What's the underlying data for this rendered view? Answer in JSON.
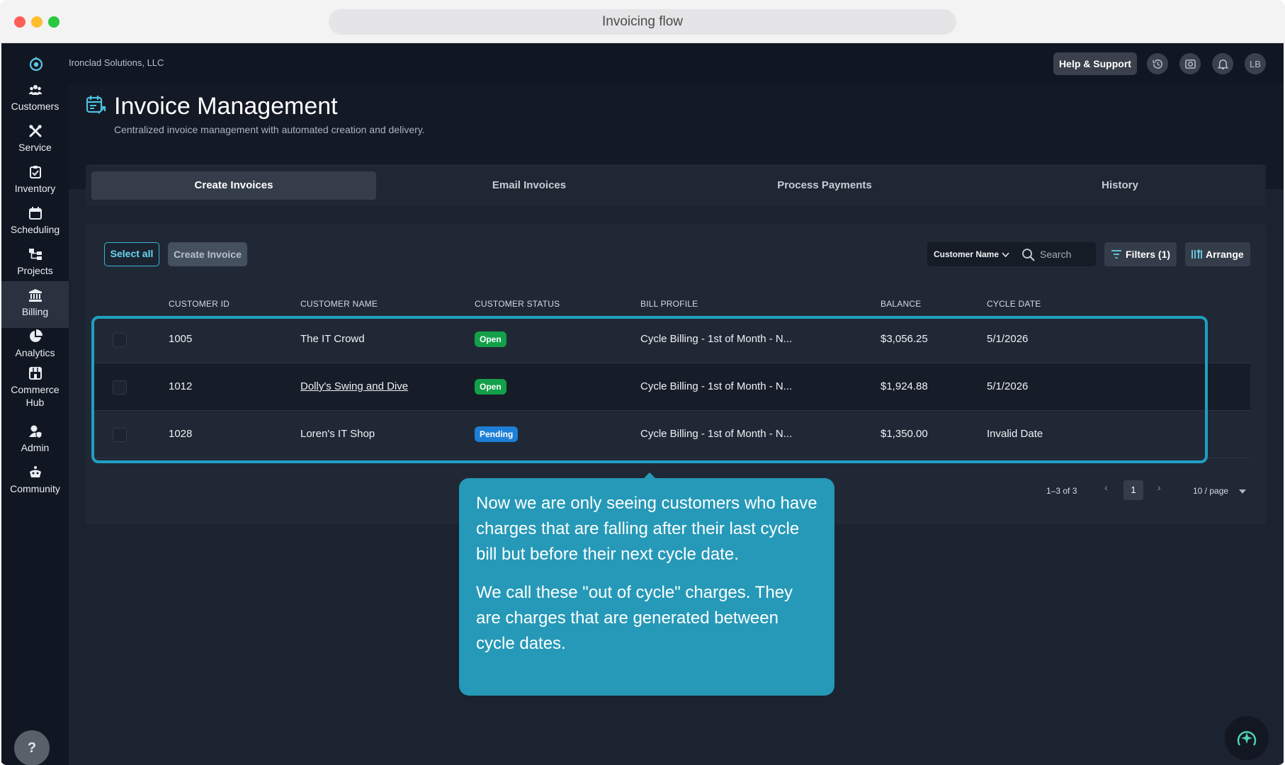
{
  "window": {
    "url_title": "Invoicing flow"
  },
  "header": {
    "company": "Ironclad Solutions, LLC",
    "help_label": "Help & Support",
    "avatar_initials": "LB"
  },
  "sidebar": {
    "items": [
      {
        "label": "Customers",
        "icon": "people-icon"
      },
      {
        "label": "Service",
        "icon": "tools-icon"
      },
      {
        "label": "Inventory",
        "icon": "clipboard-check-icon"
      },
      {
        "label": "Scheduling",
        "icon": "calendar-icon"
      },
      {
        "label": "Projects",
        "icon": "hierarchy-icon"
      },
      {
        "label": "Billing",
        "icon": "bank-icon",
        "active": true
      },
      {
        "label": "Analytics",
        "icon": "pie-chart-icon"
      },
      {
        "label": "Commerce Hub",
        "icon": "storefront-icon"
      },
      {
        "label": "Admin",
        "icon": "user-shield-icon"
      },
      {
        "label": "Community",
        "icon": "community-icon"
      }
    ],
    "help_fab": "?"
  },
  "page": {
    "title": "Invoice Management",
    "subtitle": "Centralized invoice management with automated creation and delivery."
  },
  "tabs": [
    {
      "label": "Create Invoices",
      "active": true
    },
    {
      "label": "Email Invoices"
    },
    {
      "label": "Process Payments"
    },
    {
      "label": "History"
    }
  ],
  "toolbar": {
    "select_all": "Select all",
    "create_invoice": "Create Invoice",
    "search_field": "Customer Name",
    "search_placeholder": "Search",
    "filters": "Filters (1)",
    "arrange": "Arrange"
  },
  "table": {
    "columns": [
      "CUSTOMER ID",
      "CUSTOMER NAME",
      "CUSTOMER STATUS",
      "BILL PROFILE",
      "BALANCE",
      "CYCLE DATE"
    ],
    "rows": [
      {
        "id": "1005",
        "name": "The IT Crowd",
        "status": "Open",
        "profile": "Cycle Billing - 1st of Month - N...",
        "balance": "$3,056.25",
        "cycle": "5/1/2026"
      },
      {
        "id": "1012",
        "name": "Dolly's Swing and Dive",
        "status": "Open",
        "profile": "Cycle Billing - 1st of Month - N...",
        "balance": "$1,924.88",
        "cycle": "5/1/2026"
      },
      {
        "id": "1028",
        "name": "Loren's IT Shop",
        "status": "Pending",
        "profile": "Cycle Billing - 1st of Month - N...",
        "balance": "$1,350.00",
        "cycle": "Invalid Date"
      }
    ]
  },
  "pagination": {
    "range": "1–3 of 3",
    "current_page": "1",
    "page_size": "10 / page",
    "prev": "‹",
    "next": "›"
  },
  "tooltip": {
    "p1": "Now we are only seeing customers who have charges that are falling after their last cycle bill but before their next cycle date.",
    "p2": "We call these \"out of cycle\" charges. They are charges that are generated between cycle dates."
  },
  "colors": {
    "accent": "#2699b8",
    "highlight_border": "#1fa0c1",
    "open_badge": "#13a04a",
    "pending_badge": "#1d7fd6"
  }
}
